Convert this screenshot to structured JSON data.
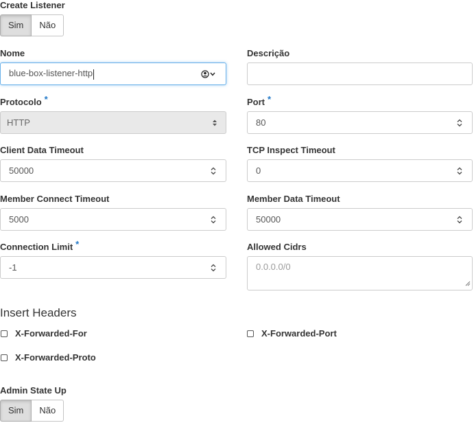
{
  "create_listener": {
    "label": "Create Listener",
    "options": [
      "Sim",
      "Não"
    ],
    "selected": "Sim"
  },
  "nome": {
    "label": "Nome",
    "value": "blue-box-listener-http"
  },
  "descricao": {
    "label": "Descrição",
    "value": ""
  },
  "protocolo": {
    "label": "Protocolo",
    "required_mark": "*",
    "value": "HTTP"
  },
  "port": {
    "label": "Port",
    "required_mark": "*",
    "value": "80"
  },
  "client_data_timeout": {
    "label": "Client Data Timeout",
    "value": "50000"
  },
  "tcp_inspect_timeout": {
    "label": "TCP Inspect Timeout",
    "value": "0"
  },
  "member_connect_timeout": {
    "label": "Member Connect Timeout",
    "value": "5000"
  },
  "member_data_timeout": {
    "label": "Member Data Timeout",
    "value": "50000"
  },
  "connection_limit": {
    "label": "Connection Limit",
    "required_mark": "*",
    "value": "-1"
  },
  "allowed_cidrs": {
    "label": "Allowed Cidrs",
    "placeholder": "0.0.0.0/0"
  },
  "insert_headers": {
    "title": "Insert Headers",
    "options": [
      {
        "label": "X-Forwarded-For",
        "checked": false
      },
      {
        "label": "X-Forwarded-Port",
        "checked": false
      },
      {
        "label": "X-Forwarded-Proto",
        "checked": false
      }
    ]
  },
  "admin_state_up": {
    "label": "Admin State Up",
    "options": [
      "Sim",
      "Não"
    ],
    "selected": "Sim"
  },
  "colors": {
    "required": "#1f77c7",
    "focus_border": "#66afe9",
    "active_toggle": "#dedede"
  }
}
